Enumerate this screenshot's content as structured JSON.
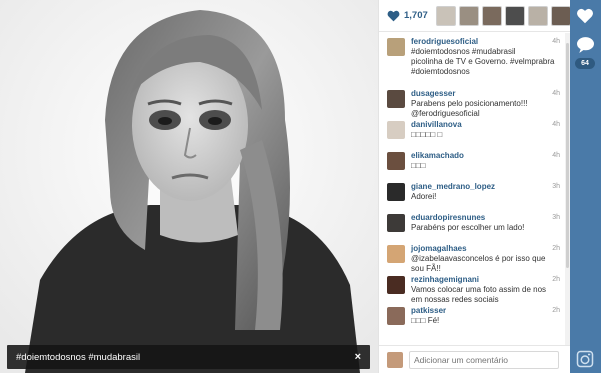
{
  "post": {
    "caption": "#doiemtodosnos #mudabrasil",
    "close_label": "×"
  },
  "likes": {
    "count": "1,707",
    "liker_colors": [
      "#c9c2b8",
      "#9a8f82",
      "#7a6a5d",
      "#4d4d4d",
      "#b9b1a6",
      "#6c5d52"
    ]
  },
  "comments": [
    {
      "user": "ferodriguesoficial",
      "text": "#doiemtodosnos #mudabrasil",
      "extra": "picolinha de TV e Governo. #velmprabra #doiemtodosnos",
      "time": "4h",
      "avatar": "#b8a07a"
    },
    {
      "user": "dusagesser",
      "text": "Parabens pelo posicionamento!!! @ferodriguesoficial",
      "time": "4h",
      "avatar": "#5a4a40"
    },
    {
      "user": "danivillanova",
      "text": "□□□□□ □",
      "time": "4h",
      "avatar": "#d7cdc2"
    },
    {
      "user": "elikamachado",
      "text": "□□□",
      "time": "4h",
      "avatar": "#6b4f3f"
    },
    {
      "user": "giane_medrano_lopez",
      "text": "Adorei!",
      "time": "3h",
      "avatar": "#2a2a2a"
    },
    {
      "user": "eduardopiresnunes",
      "text": "Parabéns por escolher um lado!",
      "time": "3h",
      "avatar": "#3d3a38"
    },
    {
      "user": "jojomagalhaes",
      "text": "@izabelaavasconcelos é por isso que sou FÃ!!",
      "time": "2h",
      "avatar": "#d4a574"
    },
    {
      "user": "rezinhagemignani",
      "text": "Vamos colocar uma foto assim de nos em nossas redes sociais",
      "time": "2h",
      "avatar": "#4a2c22"
    },
    {
      "user": "patkisser",
      "text": "□□□ Fé!",
      "time": "2h",
      "avatar": "#8a6a5a"
    }
  ],
  "add_comment": {
    "placeholder": "Adicionar um comentário",
    "avatar": "#c49a7a"
  },
  "rail": {
    "comment_count": "64"
  }
}
